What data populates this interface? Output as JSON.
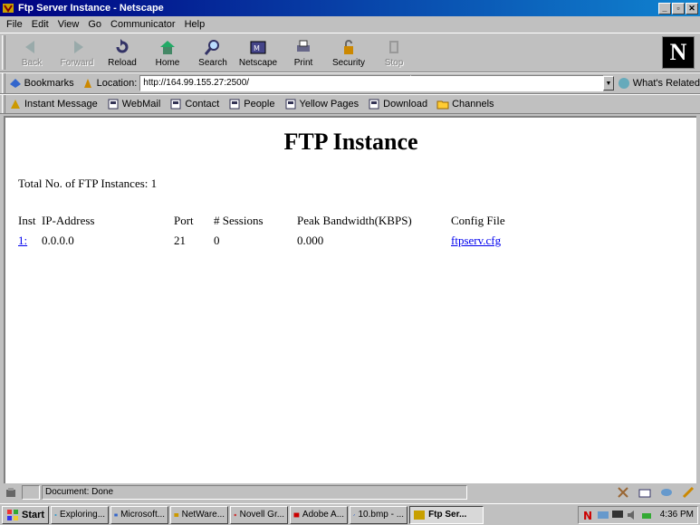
{
  "window": {
    "title": "Ftp Server Instance - Netscape",
    "buttons": [
      "_",
      "▫",
      "✕"
    ]
  },
  "menu": [
    {
      "label": "File"
    },
    {
      "label": "Edit"
    },
    {
      "label": "View"
    },
    {
      "label": "Go"
    },
    {
      "label": "Communicator"
    },
    {
      "label": "Help"
    }
  ],
  "toolbar": [
    {
      "label": "Back",
      "disabled": true
    },
    {
      "label": "Forward",
      "disabled": true
    },
    {
      "label": "Reload",
      "disabled": false
    },
    {
      "label": "Home",
      "disabled": false
    },
    {
      "label": "Search",
      "disabled": false
    },
    {
      "label": "Netscape",
      "disabled": false
    },
    {
      "label": "Print",
      "disabled": false
    },
    {
      "label": "Security",
      "disabled": false
    },
    {
      "label": "Stop",
      "disabled": true
    }
  ],
  "location": {
    "bookmarks_label": "Bookmarks",
    "location_label": "Location:",
    "url": "http://164.99.155.27:2500/",
    "related_label": "What's Related"
  },
  "personal_bar": [
    {
      "label": "Instant Message"
    },
    {
      "label": "WebMail"
    },
    {
      "label": "Contact"
    },
    {
      "label": "People"
    },
    {
      "label": "Yellow Pages"
    },
    {
      "label": "Download"
    },
    {
      "label": "Channels"
    }
  ],
  "page": {
    "title": "FTP Instance",
    "total_label": "Total No. of FTP Instances: 1",
    "headers": [
      "Inst",
      "IP-Address",
      "Port",
      "# Sessions",
      "Peak Bandwidth(KBPS)",
      "Config File"
    ],
    "rows": [
      {
        "inst": "1:",
        "ip": "0.0.0.0",
        "port": "21",
        "sessions": "0",
        "bandwidth": "0.000",
        "config": "ftpserv.cfg"
      }
    ]
  },
  "status": {
    "text": "Document: Done"
  },
  "taskbar": {
    "start": "Start",
    "tasks": [
      {
        "label": "Exploring..."
      },
      {
        "label": "Microsoft..."
      },
      {
        "label": "NetWare..."
      },
      {
        "label": "Novell Gr..."
      },
      {
        "label": "Adobe A..."
      },
      {
        "label": "10.bmp - ..."
      },
      {
        "label": "Ftp Ser..."
      }
    ],
    "active_task": "Ftp Ser...",
    "clock": "4:36 PM"
  }
}
